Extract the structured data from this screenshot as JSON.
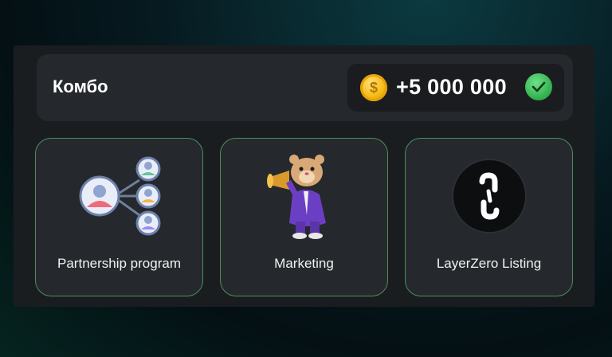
{
  "combo": {
    "title": "Комбо",
    "reward": "+5 000 000",
    "coin_icon": "coin-icon",
    "status_icon": "check-icon"
  },
  "cards": [
    {
      "label": "Partnership program",
      "icon": "referral-network-icon"
    },
    {
      "label": "Marketing",
      "icon": "hamster-megaphone-icon"
    },
    {
      "label": "LayerZero Listing",
      "icon": "layerzero-logo-icon"
    }
  ],
  "colors": {
    "card_border": "#4c8f5a",
    "check": "#2fae4a",
    "coin": "#f5b912"
  }
}
